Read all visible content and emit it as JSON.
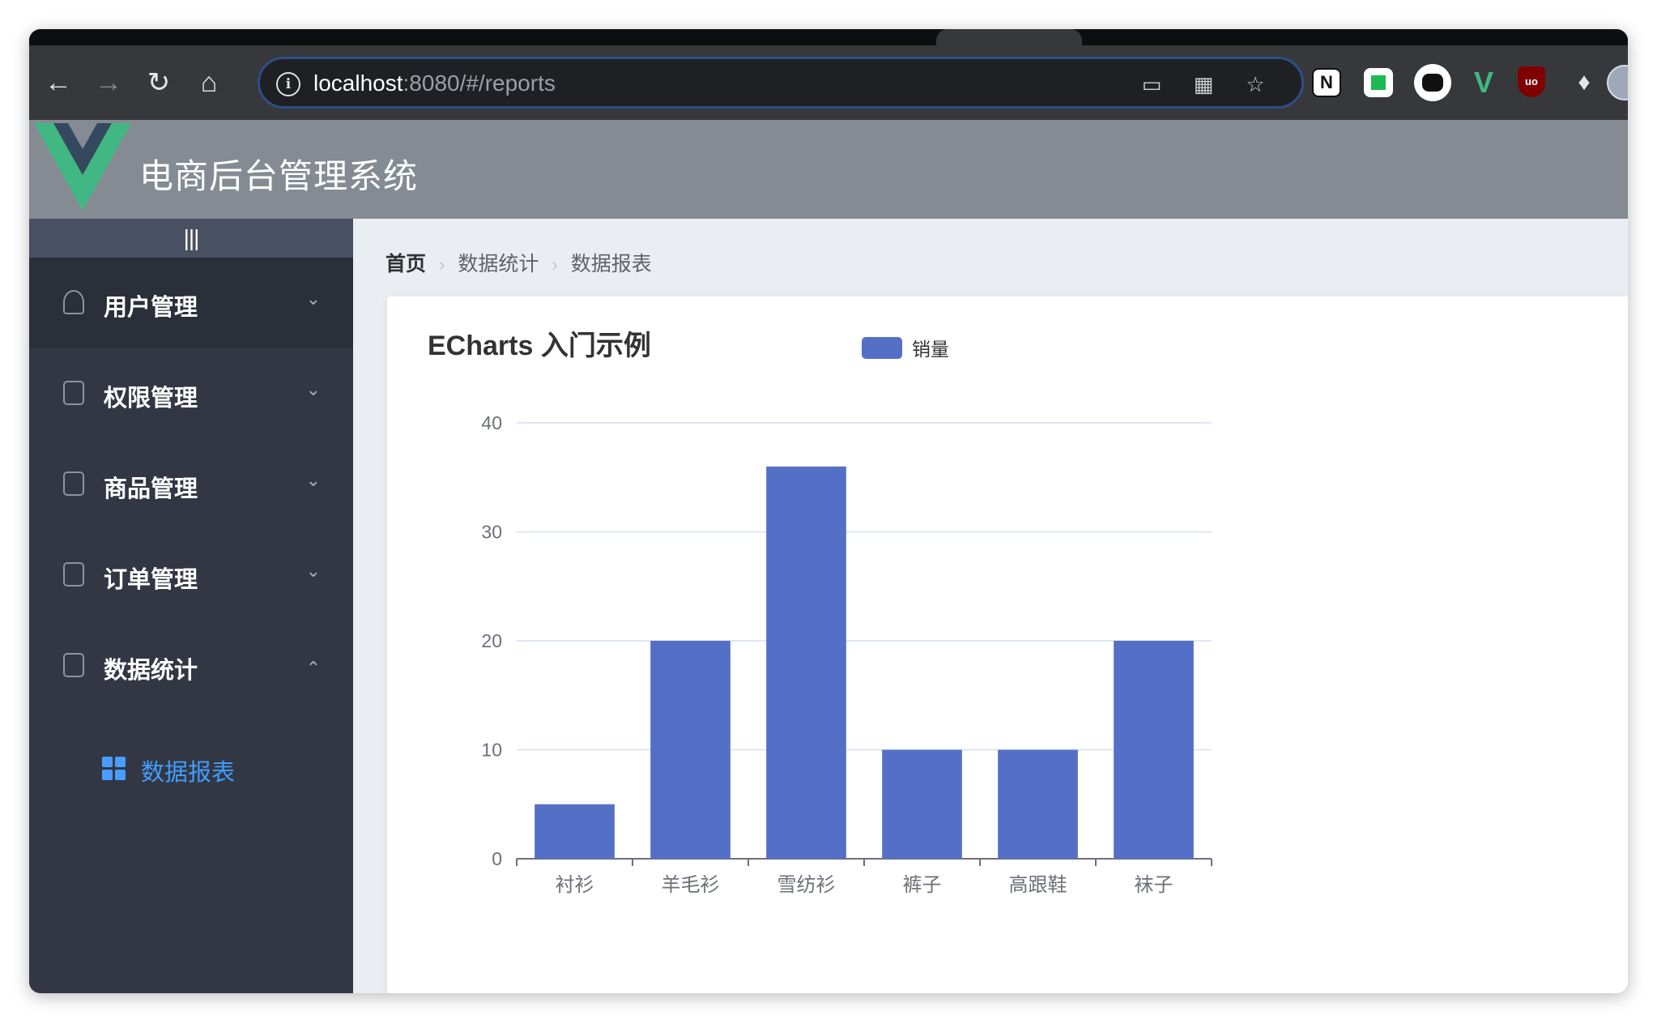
{
  "browser": {
    "url_host": "localhost",
    "url_rest": ":8080/#/reports"
  },
  "app": {
    "title": "电商后台管理系统",
    "toggle_label": "|||"
  },
  "sidebar": {
    "items": [
      {
        "label": "用户管理"
      },
      {
        "label": "权限管理"
      },
      {
        "label": "商品管理"
      },
      {
        "label": "订单管理"
      },
      {
        "label": "数据统计"
      }
    ],
    "subitem": {
      "label": "数据报表"
    }
  },
  "breadcrumb": [
    "首页",
    "数据统计",
    "数据报表"
  ],
  "colors": {
    "bar": "#5470c6",
    "accent": "#409eff",
    "sidebar_bg": "#333744",
    "header_bg": "#858b93"
  },
  "chart_data": {
    "type": "bar",
    "title": "ECharts 入门示例",
    "legend": [
      "销量"
    ],
    "legend_placement": "top-center",
    "categories": [
      "衬衫",
      "羊毛衫",
      "雪纺衫",
      "裤子",
      "高跟鞋",
      "袜子"
    ],
    "series": [
      {
        "name": "销量",
        "values": [
          5,
          20,
          36,
          10,
          10,
          20
        ]
      }
    ],
    "y_ticks": [
      "0",
      "10",
      "20",
      "30",
      "40"
    ],
    "ylim": [
      0,
      40
    ],
    "grid": true
  }
}
